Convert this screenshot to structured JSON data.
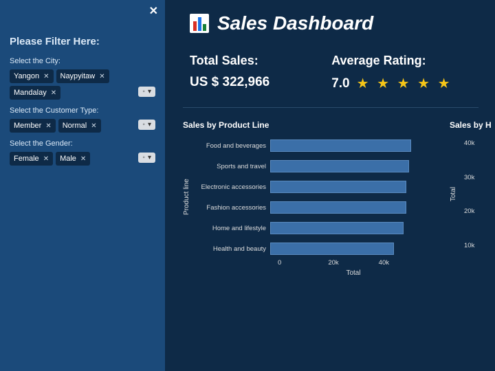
{
  "sidebar": {
    "title": "Please Filter Here:",
    "city": {
      "label": "Select the City:",
      "chips": [
        "Yangon",
        "Naypyitaw",
        "Mandalay"
      ]
    },
    "ctype": {
      "label": "Select the Customer Type:",
      "chips": [
        "Member",
        "Normal"
      ]
    },
    "gender": {
      "label": "Select the Gender:",
      "chips": [
        "Female",
        "Male"
      ]
    }
  },
  "header": {
    "title": "Sales Dashboard"
  },
  "kpi": {
    "total_label": "Total Sales:",
    "total_value": "US $ 322,966",
    "rating_label": "Average Rating:",
    "rating_value": "7.0",
    "stars": "★ ★ ★ ★ ★"
  },
  "chart_data": [
    {
      "type": "bar",
      "orientation": "horizontal",
      "title": "Sales by Product Line",
      "ylabel": "Product line",
      "xlabel": "Total",
      "categories": [
        "Food and beverages",
        "Sports and travel",
        "Electronic accessories",
        "Fashion accessories",
        "Home and lifestyle",
        "Health and beauty"
      ],
      "values": [
        56000,
        55000,
        54000,
        54000,
        53000,
        49000
      ],
      "xlim": [
        0,
        60000
      ],
      "xticks": [
        "0",
        "20k",
        "40k"
      ]
    },
    {
      "type": "bar",
      "orientation": "vertical",
      "title": "Sales by H",
      "ylabel": "Total",
      "yticks": [
        "40k",
        "30k",
        "20k",
        "10k"
      ],
      "ylim": [
        0,
        45000
      ]
    }
  ]
}
